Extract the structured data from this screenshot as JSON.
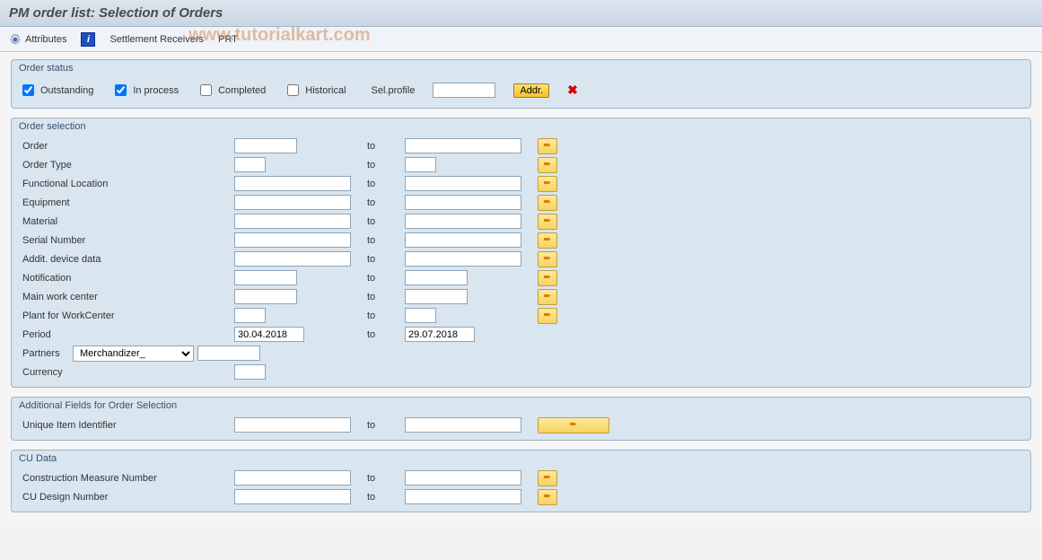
{
  "title": "PM order list: Selection of Orders",
  "watermark": "www.tutorialkart.com",
  "toolbar": {
    "attributes": "Attributes",
    "settlement": "Settlement Receivers",
    "prt": "PRT"
  },
  "groups": {
    "status": {
      "title": "Order status",
      "outstanding": "Outstanding",
      "in_process": "In process",
      "completed": "Completed",
      "historical": "Historical",
      "sel_profile_label": "Sel.profile",
      "sel_profile_value": "",
      "addr_btn": "Addr."
    },
    "selection": {
      "title": "Order selection",
      "to_label": "to",
      "fields": [
        {
          "label": "Order",
          "from": "",
          "to": "",
          "from_w": "w-med",
          "to_w": "w-full",
          "multi": true
        },
        {
          "label": "Order Type",
          "from": "",
          "to": "",
          "from_w": "w-short",
          "to_w": "w-short",
          "multi": true
        },
        {
          "label": "Functional Location",
          "from": "",
          "to": "",
          "from_w": "w-full",
          "to_w": "w-full",
          "multi": true
        },
        {
          "label": "Equipment",
          "from": "",
          "to": "",
          "from_w": "w-full",
          "to_w": "w-full",
          "multi": true
        },
        {
          "label": "Material",
          "from": "",
          "to": "",
          "from_w": "w-full",
          "to_w": "w-full",
          "multi": true
        },
        {
          "label": "Serial Number",
          "from": "",
          "to": "",
          "from_w": "w-full",
          "to_w": "w-full",
          "multi": true
        },
        {
          "label": "Addit. device data",
          "from": "",
          "to": "",
          "from_w": "w-full",
          "to_w": "w-full",
          "multi": true
        },
        {
          "label": "Notification",
          "from": "",
          "to": "",
          "from_w": "w-med",
          "to_w": "w-med",
          "multi": true
        },
        {
          "label": "Main work center",
          "from": "",
          "to": "",
          "from_w": "w-med",
          "to_w": "w-med",
          "multi": true
        },
        {
          "label": "Plant for WorkCenter",
          "from": "",
          "to": "",
          "from_w": "w-short",
          "to_w": "w-short",
          "multi": true
        },
        {
          "label": "Period",
          "from": "30.04.2018",
          "to": "29.07.2018",
          "from_w": "w-date",
          "to_w": "w-date",
          "multi": false
        }
      ],
      "partners_label": "Partners",
      "partners_select": "Merchandizer_",
      "partners_value": "",
      "currency_label": "Currency",
      "currency_value": ""
    },
    "additional": {
      "title": "Additional Fields for Order Selection",
      "to_label": "to",
      "fields": [
        {
          "label": "Unique Item Identifier",
          "from": "",
          "to": "",
          "from_w": "w-full",
          "to_w": "w-full",
          "multi_wide": true
        }
      ]
    },
    "cudata": {
      "title": "CU Data",
      "to_label": "to",
      "fields": [
        {
          "label": "Construction Measure Number",
          "from": "",
          "to": "",
          "from_w": "w-full",
          "to_w": "w-full",
          "multi": true
        },
        {
          "label": "CU Design Number",
          "from": "",
          "to": "",
          "from_w": "w-full",
          "to_w": "w-full",
          "multi": true
        }
      ]
    }
  }
}
